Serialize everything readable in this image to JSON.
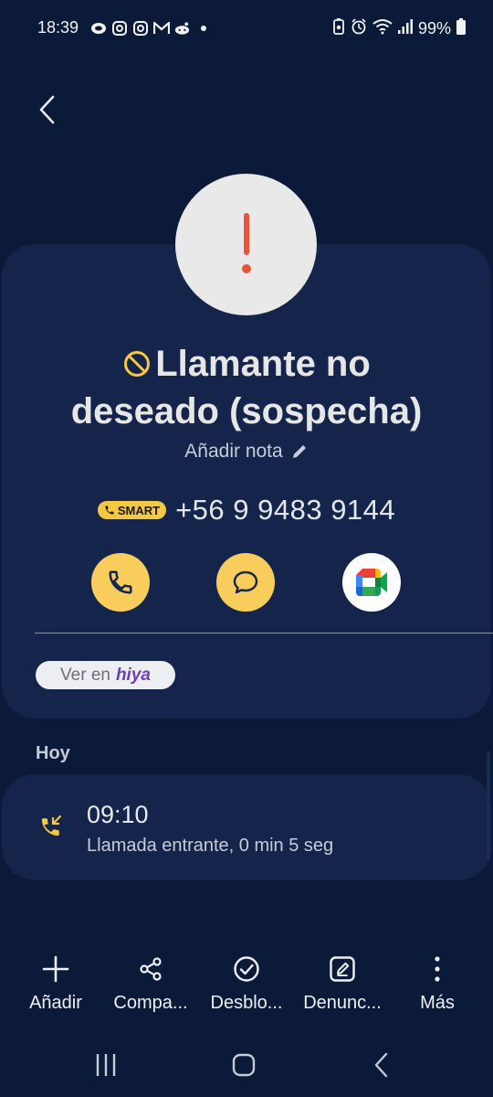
{
  "status_bar": {
    "time": "18:39",
    "battery": "99%",
    "left_icons": [
      "chat-bubble-icon",
      "instagram-icon",
      "instagram-icon",
      "gmail-icon",
      "reddit-icon",
      "dot-icon"
    ],
    "right_icons": [
      "battery-saver-icon",
      "alarm-icon",
      "wifi-icon",
      "signal-icon",
      "battery-icon"
    ]
  },
  "contact": {
    "name_line1": "Llamante no",
    "name_line2": "deseado (sospecha)",
    "add_note": "Añadir nota",
    "smart_badge": "SMART",
    "phone_number": "+56 9 9483 9144",
    "hiya_prefix": "Ver en",
    "hiya_brand": "hiya"
  },
  "history": {
    "section": "Hoy",
    "entries": [
      {
        "time": "09:10",
        "description": "Llamada entrante, 0 min 5 seg",
        "icon": "incoming-call-icon"
      }
    ]
  },
  "toolbar": {
    "add": "Añadir",
    "share": "Compa...",
    "unblock": "Desblo...",
    "report": "Denunc...",
    "more": "Más"
  },
  "colors": {
    "background": "#0b1a38",
    "card": "#14244a",
    "accent_yellow": "#f8cd5b",
    "alert_red": "#e8533c"
  }
}
